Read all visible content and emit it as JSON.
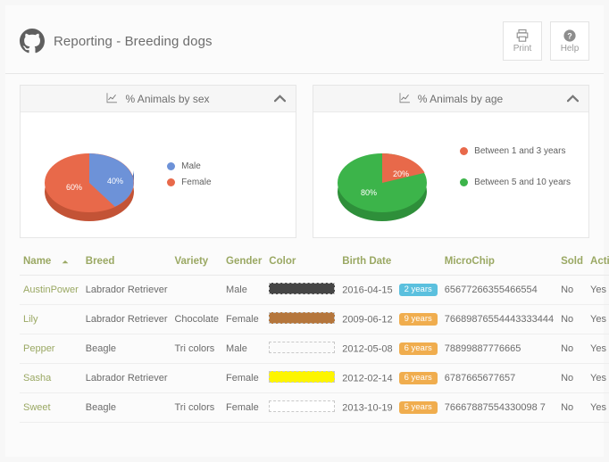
{
  "header": {
    "logo_icon": "octocat-icon",
    "title": "Reporting - Breeding dogs",
    "buttons": [
      {
        "label": "Print",
        "icon": "printer-icon"
      },
      {
        "label": "Help",
        "icon": "question-circle-icon"
      }
    ]
  },
  "panels": [
    {
      "title": "% Animals by sex",
      "icon": "line-chart-icon",
      "collapse_icon": "chevron-up-icon"
    },
    {
      "title": "% Animals by age",
      "icon": "line-chart-icon",
      "collapse_icon": "chevron-up-icon"
    }
  ],
  "chart_data": [
    {
      "type": "pie",
      "title": "% Animals by sex",
      "categories": [
        "Male",
        "Female"
      ],
      "values": [
        40,
        60
      ],
      "labels": [
        "40%",
        "60%"
      ],
      "colors": [
        "#6d92d8",
        "#e8694a"
      ],
      "legend_position": "right"
    },
    {
      "type": "pie",
      "title": "% Animals by age",
      "categories": [
        "Between  1 and 3 years",
        "Between 5 and 10 years"
      ],
      "values": [
        20,
        80
      ],
      "labels": [
        "20%",
        "80%"
      ],
      "colors": [
        "#e8694a",
        "#3cb44a"
      ],
      "legend_position": "right"
    }
  ],
  "table": {
    "sort_column": "Name",
    "sort_icon": "caret-up-icon",
    "columns": [
      "Name",
      "Breed",
      "Variety",
      "Gender",
      "Color",
      "Birth Date",
      "MicroChip",
      "Sold",
      "Active"
    ],
    "rows": [
      {
        "name": "AustinPower",
        "breed": "Labrador Retriever",
        "variety": "",
        "gender": "Male",
        "color": "#454545",
        "birth_date": "2016-04-15",
        "age_badge": "2 years",
        "age_badge_color": "#5bc0de",
        "microchip": "65677266355466554",
        "sold": "No",
        "active": "Yes"
      },
      {
        "name": "Lily",
        "breed": "Labrador Retriever",
        "variety": "Chocolate",
        "gender": "Female",
        "color": "#b5763c",
        "birth_date": "2009-06-12",
        "age_badge": "9 years",
        "age_badge_color": "#f0ad4e",
        "microchip": "76689876554443333444",
        "sold": "No",
        "active": "Yes"
      },
      {
        "name": "Pepper",
        "breed": "Beagle",
        "variety": "Tri colors",
        "gender": "Male",
        "color": "transparent",
        "birth_date": "2012-05-08",
        "age_badge": "6 years",
        "age_badge_color": "#f0ad4e",
        "microchip": "78899887776665",
        "sold": "No",
        "active": "Yes"
      },
      {
        "name": "Sasha",
        "breed": "Labrador Retriever",
        "variety": "",
        "gender": "Female",
        "color": "#fdf500",
        "birth_date": "2012-02-14",
        "age_badge": "6 years",
        "age_badge_color": "#f0ad4e",
        "microchip": "6787665677657",
        "sold": "No",
        "active": "Yes"
      },
      {
        "name": "Sweet",
        "breed": "Beagle",
        "variety": "Tri colors",
        "gender": "Female",
        "color": "#ffffff",
        "birth_date": "2013-10-19",
        "age_badge": "5 years",
        "age_badge_color": "#f0ad4e",
        "microchip": "76667887554330098 7",
        "sold": "No",
        "active": "Yes"
      }
    ]
  },
  "theme": {
    "page_bg": "#f7f7f7",
    "panel_bg": "#ffffff",
    "header_text": "#6d6d6d",
    "table_header_color": "#9aa863",
    "link_color": "#9aa863"
  }
}
